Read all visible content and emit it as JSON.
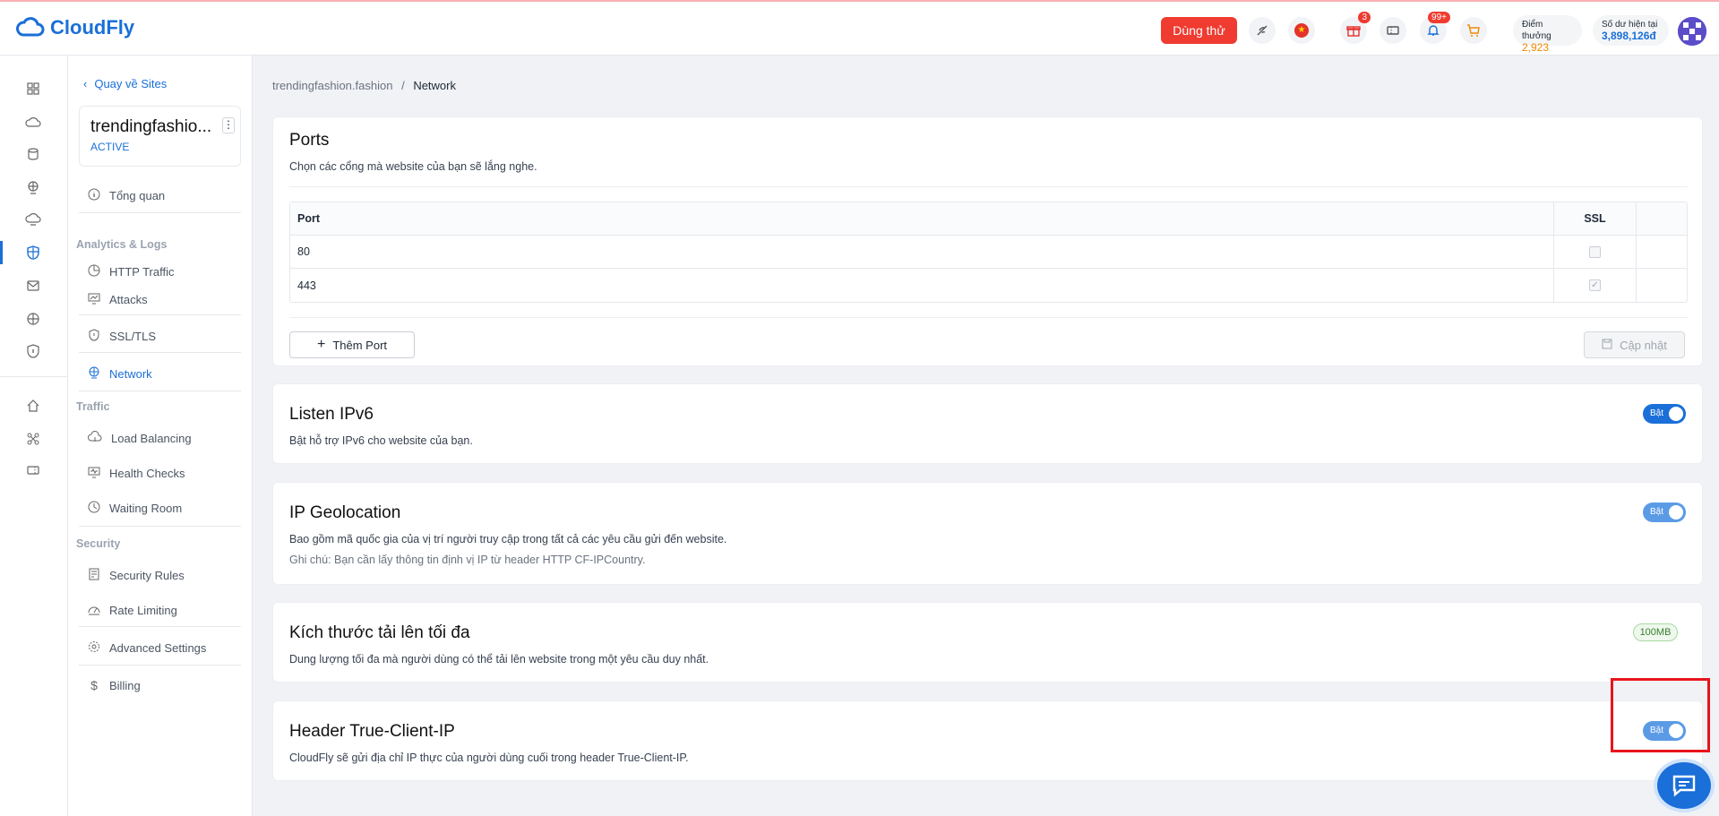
{
  "header": {
    "logo_text": "CloudFly",
    "trial_label": "Dùng thử",
    "gift_badge": "3",
    "notification_badge": "99+",
    "points_label": "Điểm thưởng",
    "points_value": "2,923",
    "balance_label": "Số dư hiện tại",
    "balance_value": "3,898,126đ"
  },
  "sidebar": {
    "back_label": "Quay về Sites",
    "site_name": "trendingfashio...",
    "site_status": "ACTIVE",
    "overview": "Tổng quan",
    "group_analytics": "Analytics & Logs",
    "http_traffic": "HTTP Traffic",
    "attacks": "Attacks",
    "ssl_tls": "SSL/TLS",
    "network": "Network",
    "group_traffic": "Traffic",
    "load_balancing": "Load Balancing",
    "health_checks": "Health Checks",
    "waiting_room": "Waiting Room",
    "group_security": "Security",
    "security_rules": "Security Rules",
    "rate_limiting": "Rate Limiting",
    "advanced_settings": "Advanced Settings",
    "billing": "Billing"
  },
  "breadcrumb": {
    "site": "trendingfashion.fashion",
    "separator": "/",
    "current": "Network"
  },
  "ports": {
    "title": "Ports",
    "description": "Chọn các cổng mà website của bạn sẽ lắng nghe.",
    "col_port": "Port",
    "col_ssl": "SSL",
    "rows": [
      {
        "port": "80",
        "ssl": ""
      },
      {
        "port": "443",
        "ssl": "✓"
      }
    ],
    "add_label": "Thêm Port",
    "update_label": "Cập nhật"
  },
  "ipv6": {
    "title": "Listen IPv6",
    "description": "Bật hỗ trợ IPv6 cho website của bạn.",
    "toggle_label": "Bật"
  },
  "geo": {
    "title": "IP Geolocation",
    "description": "Bao gồm mã quốc gia của vị trí người truy cập trong tất cả các yêu cầu gửi đến website.",
    "note": "Ghi chú: Bạn cần lấy thông tin định vị IP từ header HTTP CF-IPCountry.",
    "toggle_label": "Bật"
  },
  "upload": {
    "title": "Kích thước tải lên tối đa",
    "description": "Dung lượng tối đa mà người dùng có thể tải lên website trong một yêu cầu duy nhất.",
    "size": "100MB"
  },
  "true_client_ip": {
    "title": "Header True-Client-IP",
    "description": "CloudFly sẽ gửi địa chỉ IP thực của người dùng cuối trong header True-Client-IP.",
    "toggle_label": "Bật"
  },
  "colors": {
    "accent": "#1a6fd8",
    "danger": "#ef3b30"
  }
}
